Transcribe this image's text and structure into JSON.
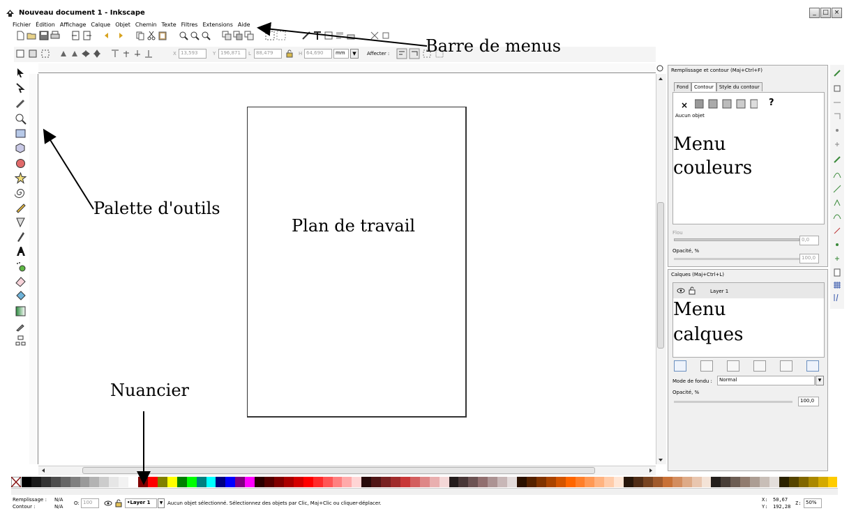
{
  "window": {
    "title": "Nouveau document 1 - Inkscape",
    "buttons": [
      "_",
      "□",
      "×"
    ]
  },
  "menu": [
    "Fichier",
    "Édition",
    "Affichage",
    "Calque",
    "Objet",
    "Chemin",
    "Texte",
    "Filtres",
    "Extensions",
    "Aide"
  ],
  "controlbar": {
    "x_label": "X",
    "x_value": "13,593",
    "y_label": "Y",
    "y_value": "196,871",
    "w_label": "L",
    "w_value": "88,479",
    "h_label": "H",
    "h_value": "64,690",
    "unit": "mm",
    "affect_label": "Affecter :"
  },
  "fill_stroke_dialog": {
    "title": "Remplissage et contour (Maj+Ctrl+F)",
    "tabs": [
      "Fond",
      "Contour",
      "Style du contour"
    ],
    "active_tab_index": 1,
    "no_paint": "×",
    "unknown": "?",
    "status": "Aucun objet",
    "blur_label": "Flou",
    "blur_value": "0,0",
    "opacity_label": "Opacité, %",
    "opacity_value": "100,0"
  },
  "layers_dialog": {
    "title": "Calques (Maj+Ctrl+L)",
    "layer_name": "Layer 1",
    "blend_label": "Mode de fondu :",
    "blend_value": "Normal",
    "opacity_label": "Opacité, %",
    "opacity_value": "100,0"
  },
  "statusbar": {
    "fill_label": "Remplissage :",
    "fill_value": "N/A",
    "stroke_label": "Contour :",
    "stroke_value": "N/A",
    "opacity_label": "O:",
    "opacity_value": "100",
    "layer_value": "•Layer 1",
    "message": "Aucun objet sélectionné. Sélectionnez des objets par Clic, Maj+Clic ou cliquer-déplacer.",
    "x_label": "X:",
    "x_value": "50,67",
    "y_label": "Y:",
    "y_value": "192,28",
    "zoom_label": "Z:",
    "zoom_value": "50%"
  },
  "annotations": {
    "menubar": "Barre de menus",
    "tools": "Palette d'outils",
    "workspace": "Plan de travail",
    "colors_line1": "Menu",
    "colors_line2": "couleurs",
    "layers_line1": "Menu",
    "layers_line2": "calques",
    "swatches": "Nuancier"
  },
  "palette": {
    "colors": [
      "#000000",
      "#1a1a1a",
      "#333333",
      "#4d4d4d",
      "#666666",
      "#808080",
      "#999999",
      "#b3b3b3",
      "#cccccc",
      "#e6e6e6",
      "#f2f2f2",
      "#ffffff",
      "#800000",
      "#ff0000",
      "#808000",
      "#ffff00",
      "#008000",
      "#00ff00",
      "#008080",
      "#00ffff",
      "#000080",
      "#0000ff",
      "#800080",
      "#ff00ff",
      "#2b0000",
      "#550000",
      "#800000",
      "#aa0000",
      "#d40000",
      "#ff0000",
      "#ff2a2a",
      "#ff5555",
      "#ff8080",
      "#ffaaaa",
      "#ffd5d5",
      "#280b0b",
      "#501616",
      "#782121",
      "#a02c2c",
      "#c83737",
      "#d35f5f",
      "#de8787",
      "#e9afaf",
      "#f4d7d7",
      "#241c1c",
      "#483737",
      "#6c5353",
      "#916f6f",
      "#ac9393",
      "#c8b7b7",
      "#e3dbdb",
      "#2b1100",
      "#552200",
      "#803300",
      "#aa4400",
      "#d45500",
      "#ff6600",
      "#ff7f2a",
      "#ff9955",
      "#ffb380",
      "#ffccaa",
      "#ffe6d5",
      "#28170b",
      "#502d16",
      "#784421",
      "#a05a2c",
      "#c87137",
      "#d38d5f",
      "#deaa87",
      "#e9c6af",
      "#f4e3d7",
      "#241f1c",
      "#483e37",
      "#6c5d53",
      "#917c6f",
      "#ac9d93",
      "#c8beb7",
      "#e3dedb",
      "#2b2200",
      "#554400",
      "#806600",
      "#aa8800",
      "#d4aa00",
      "#ffcc00"
    ]
  }
}
